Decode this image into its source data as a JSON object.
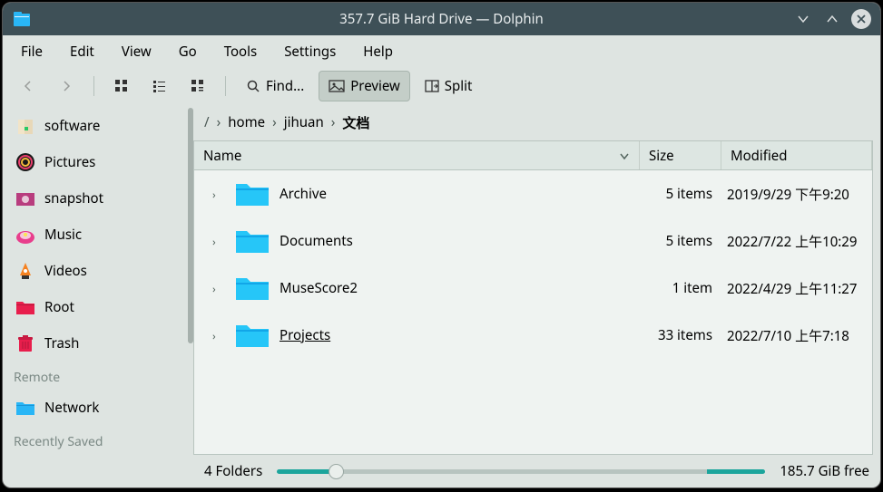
{
  "window": {
    "title": "357.7 GiB Hard Drive — Dolphin"
  },
  "menubar": {
    "file": "File",
    "edit": "Edit",
    "view": "View",
    "go": "Go",
    "tools": "Tools",
    "settings": "Settings",
    "help": "Help"
  },
  "toolbar": {
    "find": "Find...",
    "preview": "Preview",
    "split": "Split"
  },
  "sidebar": {
    "items": [
      {
        "label": "software"
      },
      {
        "label": "Pictures"
      },
      {
        "label": "snapshot"
      },
      {
        "label": "Music"
      },
      {
        "label": "Videos"
      },
      {
        "label": "Root"
      },
      {
        "label": "Trash"
      }
    ],
    "remote_section": "Remote",
    "network": "Network",
    "recent_section": "Recently Saved"
  },
  "breadcrumb": {
    "home": "home",
    "user": "jihuan",
    "current": "文档"
  },
  "columns": {
    "name": "Name",
    "size": "Size",
    "modified": "Modified"
  },
  "files": [
    {
      "name": "Archive",
      "size": "5 items",
      "modified": "2019/9/29 下午9:20"
    },
    {
      "name": "Documents",
      "size": "5 items",
      "modified": "2022/7/22 上午10:29"
    },
    {
      "name": "MuseScore2",
      "size": "1 item",
      "modified": "2022/4/29 上午11:27"
    },
    {
      "name": "Projects",
      "size": "33 items",
      "modified": "2022/7/10 上午7:18",
      "underline": true
    }
  ],
  "status": {
    "count": "4 Folders",
    "free": "185.7 GiB free"
  }
}
